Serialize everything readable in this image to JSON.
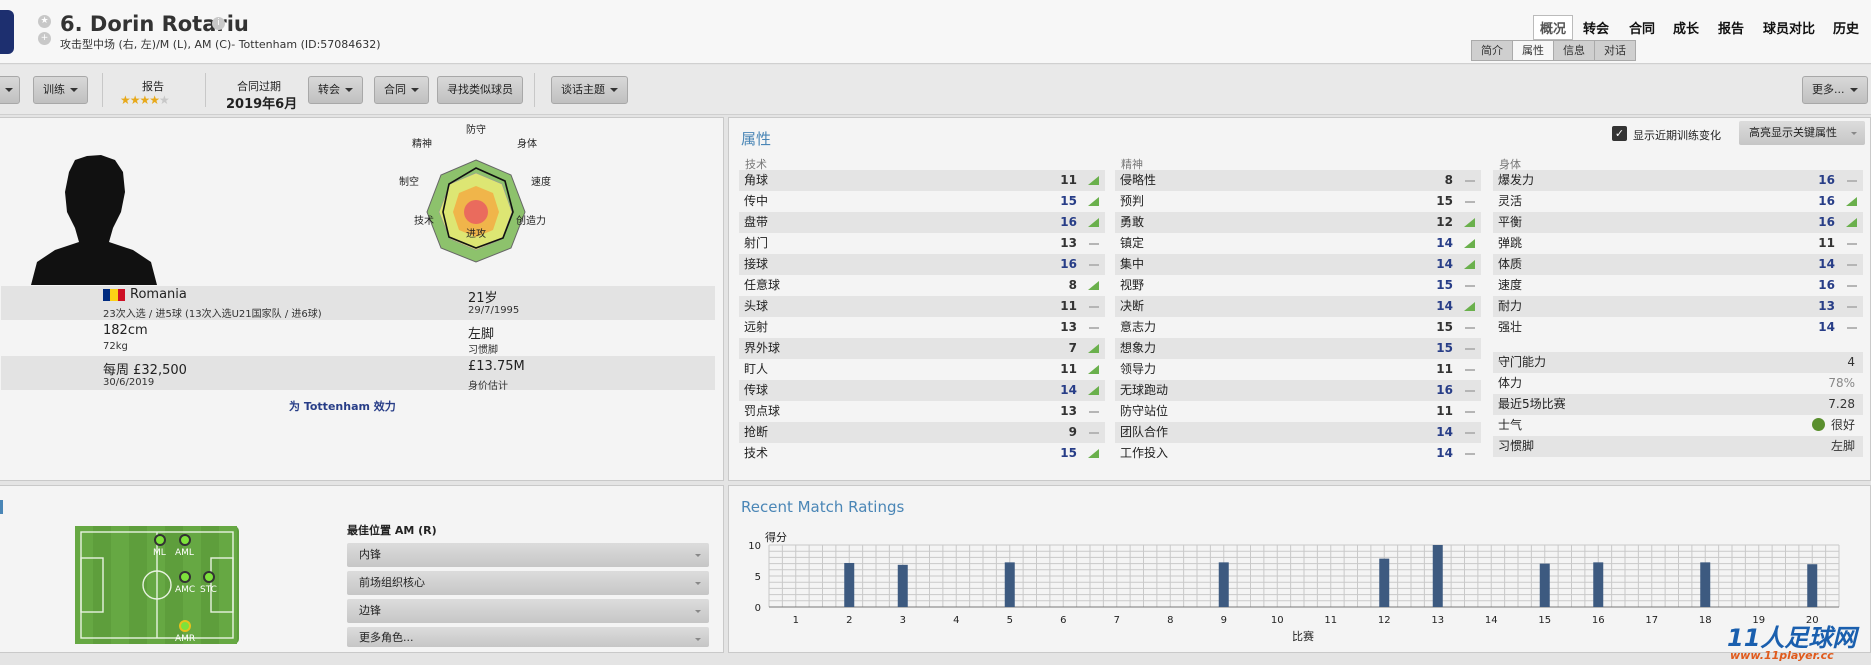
{
  "header": {
    "name": "6. Dorin Rotariu",
    "subtitle": "攻击型中场 (右, 左)/M (L), AM (C)- Tottenham (ID:57084632)",
    "nav": [
      "概况",
      "转会",
      "合同",
      "成长",
      "报告",
      "球员对比",
      "历史"
    ],
    "subtabs": [
      "简介",
      "属性",
      "信息",
      "对话"
    ]
  },
  "toolbar": {
    "train": "训练",
    "report_label": "报告",
    "stars": "★★★★",
    "stars_half": "★",
    "contract_label": "合同过期",
    "contract_value": "2019年6月",
    "transfer": "转会",
    "contract": "合同",
    "find_similar": "寻找类似球员",
    "talk": "谈话主题",
    "more": "更多..."
  },
  "radar": {
    "labels": [
      "防守",
      "身体",
      "速度",
      "创造力",
      "进攻",
      "技术",
      "制空",
      "精神"
    ]
  },
  "bio": {
    "nation": "Romania",
    "caps": "23次入选 / 进5球 (13次入选U21国家队 / 进6球)",
    "age": "21岁",
    "dob": "29/7/1995",
    "height": "182cm",
    "weight": "72kg",
    "foot": "左脚",
    "foot_label": "习惯脚",
    "wage": "每周 £32,500",
    "wage_expiry": "30/6/2019",
    "value": "£13.75M",
    "value_label": "身价估计",
    "plays_for": "为 Tottenham 效力"
  },
  "attributes": {
    "title": "属性",
    "show_training": "显示近期训练变化",
    "highlight": "高亮显示关键属性",
    "technical_h": "技术",
    "mental_h": "精神",
    "physical_h": "身体",
    "technical": [
      {
        "n": "角球",
        "v": "11",
        "t": "up",
        "hi": false
      },
      {
        "n": "传中",
        "v": "15",
        "t": "up",
        "hi": true
      },
      {
        "n": "盘带",
        "v": "16",
        "t": "up",
        "hi": true
      },
      {
        "n": "射门",
        "v": "13",
        "t": "flat",
        "hi": false
      },
      {
        "n": "接球",
        "v": "16",
        "t": "flat",
        "hi": true
      },
      {
        "n": "任意球",
        "v": "8",
        "t": "up",
        "hi": false
      },
      {
        "n": "头球",
        "v": "11",
        "t": "flat",
        "hi": false
      },
      {
        "n": "远射",
        "v": "13",
        "t": "flat",
        "hi": false
      },
      {
        "n": "界外球",
        "v": "7",
        "t": "up",
        "hi": false
      },
      {
        "n": "盯人",
        "v": "11",
        "t": "up",
        "hi": false
      },
      {
        "n": "传球",
        "v": "14",
        "t": "up",
        "hi": true
      },
      {
        "n": "罚点球",
        "v": "13",
        "t": "flat",
        "hi": false
      },
      {
        "n": "抢断",
        "v": "9",
        "t": "flat",
        "hi": false
      },
      {
        "n": "技术",
        "v": "15",
        "t": "up",
        "hi": true
      }
    ],
    "mental": [
      {
        "n": "侵略性",
        "v": "8",
        "t": "flat",
        "hi": false
      },
      {
        "n": "预判",
        "v": "15",
        "t": "flat",
        "hi": false
      },
      {
        "n": "勇敢",
        "v": "12",
        "t": "up",
        "hi": false
      },
      {
        "n": "镇定",
        "v": "14",
        "t": "up",
        "hi": true
      },
      {
        "n": "集中",
        "v": "14",
        "t": "up",
        "hi": true
      },
      {
        "n": "视野",
        "v": "15",
        "t": "flat",
        "hi": true
      },
      {
        "n": "决断",
        "v": "14",
        "t": "up",
        "hi": true
      },
      {
        "n": "意志力",
        "v": "15",
        "t": "flat",
        "hi": false
      },
      {
        "n": "想象力",
        "v": "15",
        "t": "flat",
        "hi": true
      },
      {
        "n": "领导力",
        "v": "11",
        "t": "flat",
        "hi": false
      },
      {
        "n": "无球跑动",
        "v": "16",
        "t": "flat",
        "hi": true
      },
      {
        "n": "防守站位",
        "v": "11",
        "t": "flat",
        "hi": false
      },
      {
        "n": "团队合作",
        "v": "14",
        "t": "flat",
        "hi": true
      },
      {
        "n": "工作投入",
        "v": "14",
        "t": "flat",
        "hi": true
      }
    ],
    "physical": [
      {
        "n": "爆发力",
        "v": "16",
        "t": "flat",
        "hi": true
      },
      {
        "n": "灵活",
        "v": "16",
        "t": "up",
        "hi": true
      },
      {
        "n": "平衡",
        "v": "16",
        "t": "up",
        "hi": true
      },
      {
        "n": "弹跳",
        "v": "11",
        "t": "flat",
        "hi": false
      },
      {
        "n": "体质",
        "v": "14",
        "t": "flat",
        "hi": true
      },
      {
        "n": "速度",
        "v": "16",
        "t": "flat",
        "hi": true
      },
      {
        "n": "耐力",
        "v": "13",
        "t": "flat",
        "hi": true
      },
      {
        "n": "强壮",
        "v": "14",
        "t": "flat",
        "hi": true
      }
    ],
    "extra": [
      {
        "n": "守门能力",
        "v": "4"
      },
      {
        "n": "体力",
        "v": "78%"
      },
      {
        "n": "最近5场比赛",
        "v": "7.28"
      },
      {
        "n": "士气",
        "v": "很好"
      },
      {
        "n": "习惯脚",
        "v": "左脚"
      }
    ]
  },
  "positions": {
    "best": "最佳位置 AM (R)",
    "pitch_labels": [
      "ML",
      "AML",
      "AMC",
      "STC",
      "AMR"
    ],
    "roles": [
      "内锋",
      "前场组织核心",
      "边锋",
      "更多角色..."
    ]
  },
  "chart_data": {
    "type": "bar",
    "title": "Recent Match Ratings",
    "ylabel": "得分",
    "xlabel": "比赛",
    "ylim": [
      0,
      10
    ],
    "yticks": [
      "0",
      "5",
      "10"
    ],
    "categories": [
      "1",
      "2",
      "3",
      "4",
      "5",
      "6",
      "7",
      "8",
      "9",
      "10",
      "11",
      "12",
      "13",
      "14",
      "15",
      "16",
      "17",
      "18",
      "19",
      "20"
    ],
    "values": [
      0,
      7.1,
      6.8,
      0,
      7.2,
      0,
      0,
      0,
      7.2,
      0,
      0,
      7.8,
      10,
      0,
      7.0,
      7.2,
      0,
      7.2,
      0,
      6.9
    ],
    "bar_color": "#3d5a80"
  },
  "watermark": {
    "text": "11人足球网",
    "url": "www.11player.cc"
  }
}
